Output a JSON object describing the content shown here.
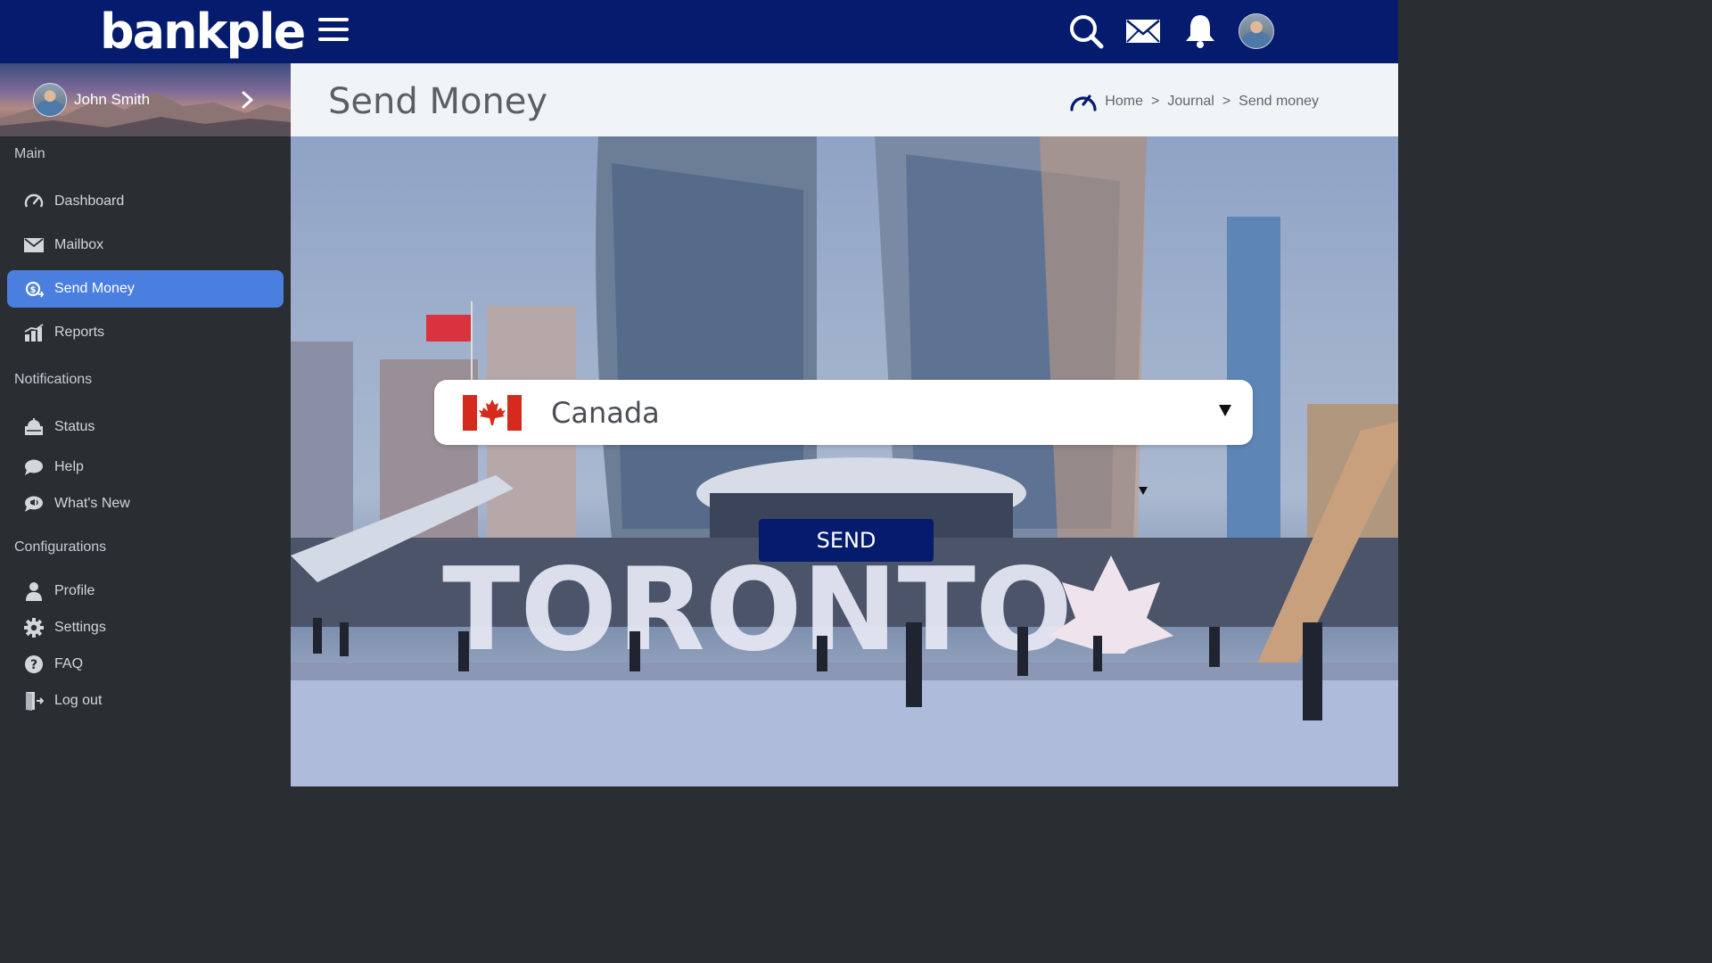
{
  "app": {
    "logo_text": "bankple",
    "brand_color": "#041b6e",
    "accent_color": "#4a7fe0"
  },
  "topbar": {
    "icons": [
      "menu-icon",
      "search-icon",
      "mail-icon",
      "bell-icon",
      "avatar"
    ]
  },
  "user": {
    "name": "John Smith"
  },
  "sidebar": {
    "sections": {
      "main": "Main",
      "notifications": "Notifications",
      "configurations": "Configurations"
    },
    "items": {
      "dashboard": {
        "label": "Dashboard",
        "icon": "speedometer-icon"
      },
      "mailbox": {
        "label": "Mailbox",
        "icon": "envelope-icon"
      },
      "send_money": {
        "label": "Send Money",
        "icon": "money-transfer-icon",
        "active": true
      },
      "reports": {
        "label": "Reports",
        "icon": "bar-chart-icon"
      },
      "status": {
        "label": "Status",
        "icon": "status-icon"
      },
      "help": {
        "label": "Help",
        "icon": "chat-bubble-icon"
      },
      "whats_new": {
        "label": "What's New",
        "icon": "megaphone-icon"
      },
      "profile": {
        "label": "Profile",
        "icon": "user-icon"
      },
      "settings": {
        "label": "Settings",
        "icon": "gear-icon"
      },
      "faq": {
        "label": "FAQ",
        "icon": "question-icon"
      },
      "logout": {
        "label": "Log out",
        "icon": "door-exit-icon"
      }
    }
  },
  "header": {
    "title": "Send Money",
    "breadcrumb": {
      "home": "Home",
      "journal": "Journal",
      "current": "Send money",
      "separator": ">"
    }
  },
  "form": {
    "country": "Canada",
    "send_label": "SEND"
  },
  "hero": {
    "sign_text": "TORONTO"
  }
}
